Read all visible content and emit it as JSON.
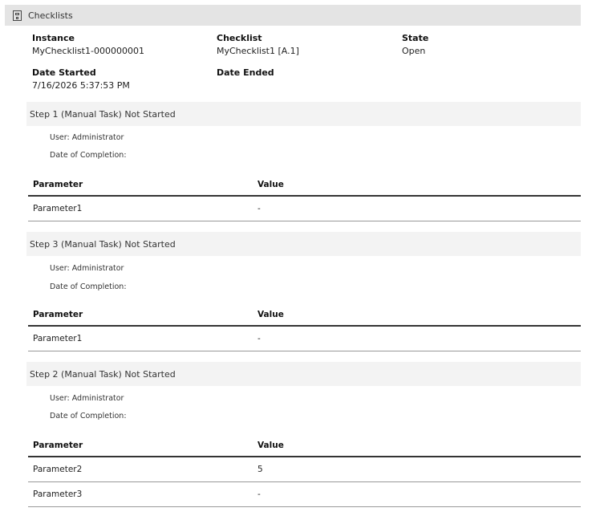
{
  "header": {
    "title": "Checklists",
    "icon": "checklist-icon"
  },
  "instance_info": {
    "instance_label": "Instance",
    "instance_value": "MyChecklist1-000000001",
    "checklist_label": "Checklist",
    "checklist_value": "MyChecklist1 [A.1]",
    "state_label": "State",
    "state_value": "Open",
    "date_started_label": "Date Started",
    "date_started_value": "7/16/2026 5:37:53 PM",
    "date_ended_label": "Date Ended"
  },
  "steps": [
    {
      "title": "Step 1 (Manual Task) Not Started",
      "user": "User: Administrator",
      "completion": "Date of Completion:",
      "columns": [
        "Parameter",
        "Value"
      ],
      "rows": [
        {
          "parameter": "Parameter1",
          "value": "-"
        }
      ]
    },
    {
      "title": "Step 3 (Manual Task) Not Started",
      "user": "User: Administrator",
      "completion": "Date of Completion:",
      "columns": [
        "Parameter",
        "Value"
      ],
      "rows": [
        {
          "parameter": "Parameter1",
          "value": "-"
        }
      ]
    },
    {
      "title": "Step 2 (Manual Task) Not Started",
      "user": "User: Administrator",
      "completion": "Date of Completion:",
      "columns": [
        "Parameter",
        "Value"
      ],
      "rows": [
        {
          "parameter": "Parameter2",
          "value": "5"
        },
        {
          "parameter": "Parameter3",
          "value": "-"
        }
      ]
    }
  ]
}
